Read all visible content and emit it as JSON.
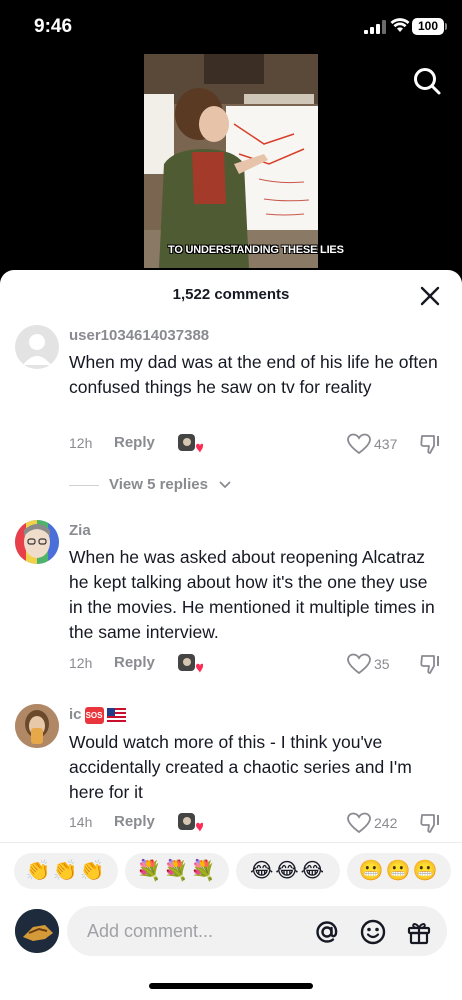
{
  "status_bar": {
    "time": "9:46",
    "battery": "100"
  },
  "video": {
    "caption": "TO UNDERSTANDING THESE LIES"
  },
  "comments_header": {
    "count_label": "1,522 comments"
  },
  "comments": [
    {
      "username": "user1034614037388",
      "text": "When my dad was at the end of his life he often confused things he saw on tv for reality",
      "time": "12h",
      "reply_label": "Reply",
      "likes": "437"
    },
    {
      "username": "Zia",
      "text": "When he was asked about reopening Alcatraz he kept talking about how it's the one they use in the movies. He mentioned it multiple times in the same interview.",
      "time": "12h",
      "reply_label": "Reply",
      "likes": "35"
    },
    {
      "username": "ic",
      "badge": "SOS",
      "text": "Would watch more of this - I think you've accidentally created a chaotic series and I'm here for it",
      "time": "14h",
      "reply_label": "Reply",
      "likes": "242"
    }
  ],
  "view_replies_label": "View 5 replies",
  "quick_emojis": [
    {
      "emojis": "👏👏👏",
      "name": "clap"
    },
    {
      "emojis": "💐💐💐",
      "name": "bouquet"
    },
    {
      "emojis": "😂😂😂",
      "name": "tears-of-joy"
    },
    {
      "emojis": "😬😬😬",
      "name": "grimacing"
    }
  ],
  "input": {
    "placeholder": "Add comment..."
  },
  "colors": {
    "muted": "#8a8b91",
    "text": "#161823",
    "heart": "#fe2c55",
    "chip": "#f1f1f2"
  }
}
